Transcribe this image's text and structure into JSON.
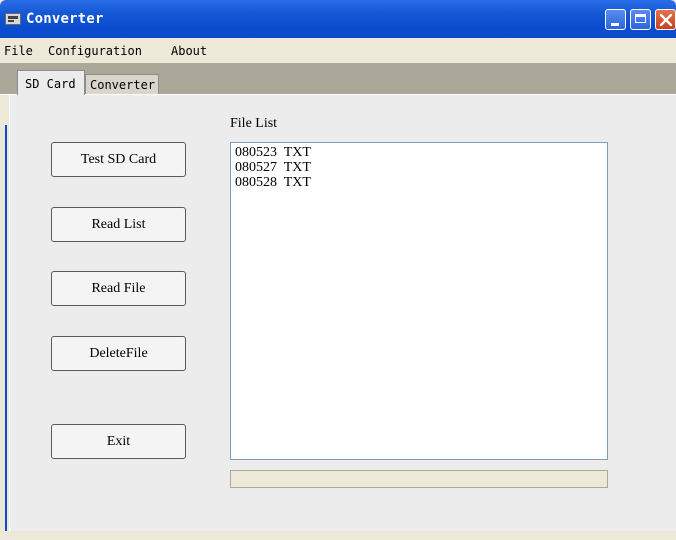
{
  "window": {
    "title": "Converter",
    "icon": "app-icon",
    "controls": [
      "minimize-icon",
      "maximize-icon",
      "close-icon"
    ]
  },
  "menu": {
    "file": "File",
    "configuration": "Configuration",
    "about": "About"
  },
  "tabs": {
    "sd_card": "SD Card",
    "converter": "Converter",
    "active": "SD Card"
  },
  "buttons": {
    "test_sd_card": "Test SD Card",
    "read_list": "Read List",
    "read_file": "Read File",
    "delete_file": "DeleteFile",
    "exit": "Exit"
  },
  "file_list": {
    "label": "File List",
    "items": [
      "080523  TXT",
      "080527  TXT",
      "080528  TXT"
    ]
  },
  "progress": {
    "value": 0
  },
  "colors": {
    "titlebar": "#0a4bcf",
    "panel": "#ececec",
    "window_bg": "#ece9d8",
    "listbox_border": "#7f9db9"
  }
}
